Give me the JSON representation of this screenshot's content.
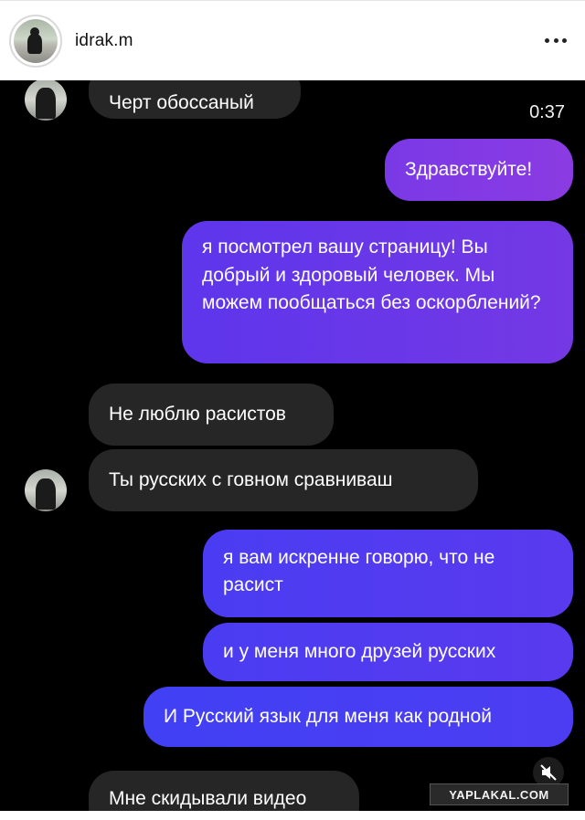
{
  "header": {
    "username": "idrak.m",
    "more_icon": "more-horizontal-icon"
  },
  "chat": {
    "timestamp": "0:37",
    "messages": [
      {
        "from": "them",
        "text": "Черт обоссаный"
      },
      {
        "from": "me",
        "text": "Здравствуйте!"
      },
      {
        "from": "me",
        "text": "я посмотрел вашу страницу! Вы добрый и здоровый человек. Мы можем пообщаться без оскорблений?"
      },
      {
        "from": "them",
        "text": "Не люблю расистов"
      },
      {
        "from": "them",
        "text": "Ты русских с говном сравниваш"
      },
      {
        "from": "me",
        "text": "я вам искренне говорю, что не расист"
      },
      {
        "from": "me",
        "text": "и у меня много друзей русских"
      },
      {
        "from": "me",
        "text": "И Русский язык для меня как родной"
      },
      {
        "from": "them",
        "text": "Мне скидывали видео"
      }
    ]
  },
  "watermark": {
    "text": "YAPLAKAL.COM"
  },
  "colors": {
    "background": "#000000",
    "received_bubble": "#262626",
    "sent_bubble_start": "#4f3af0",
    "sent_bubble_end": "#7c3ce0"
  }
}
